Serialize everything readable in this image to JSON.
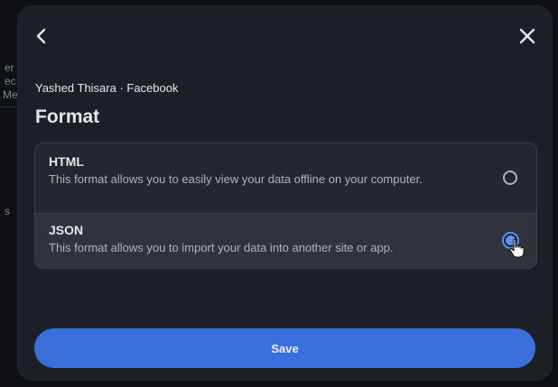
{
  "background": {
    "fragments": [
      "er",
      "ec",
      "Me",
      "s"
    ]
  },
  "dialog": {
    "back_icon": "chevron-left-icon",
    "close_icon": "close-icon",
    "account_line": "Yashed Thisara · Facebook",
    "title": "Format",
    "options": [
      {
        "label": "HTML",
        "description": "This format allows you to easily view your data offline on your computer.",
        "selected": false
      },
      {
        "label": "JSON",
        "description": "This format allows you to import your data into another site or app.",
        "selected": true
      }
    ],
    "save_label": "Save",
    "colors": {
      "accent": "#3b6fdb",
      "radio_selected": "#5e8ef0",
      "dialog_bg": "#1c2026"
    }
  }
}
